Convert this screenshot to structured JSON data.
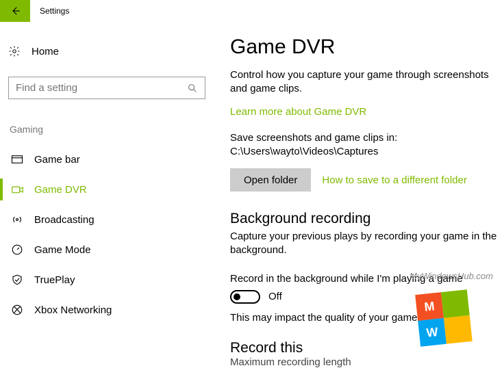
{
  "app": {
    "title": "Settings"
  },
  "sidebar": {
    "home_label": "Home",
    "search_placeholder": "Find a setting",
    "section_label": "Gaming",
    "items": [
      {
        "label": "Game bar"
      },
      {
        "label": "Game DVR"
      },
      {
        "label": "Broadcasting"
      },
      {
        "label": "Game Mode"
      },
      {
        "label": "TruePlay"
      },
      {
        "label": "Xbox Networking"
      }
    ]
  },
  "content": {
    "page_title": "Game DVR",
    "intro": "Control how you capture your game through screenshots and game clips.",
    "learn_more": "Learn more about Game DVR",
    "save_path_line": "Save screenshots and game clips in: C:\\Users\\wayto\\Videos\\Captures",
    "open_folder_label": "Open folder",
    "how_to_save_link": "How to save to a different folder",
    "bg_recording_title": "Background recording",
    "bg_recording_desc": "Capture your previous plays by recording your game in the background.",
    "bg_toggle_label": "Record in the background while I'm playing a game",
    "bg_toggle_state": "Off",
    "bg_impact_note": "This may impact the quality of your game.",
    "record_this_title": "Record this",
    "record_this_cutoff": "Maximum recording length"
  },
  "watermark": {
    "text": "MyWindowsHub.com",
    "tiles": [
      "M",
      "",
      "W",
      ""
    ]
  }
}
